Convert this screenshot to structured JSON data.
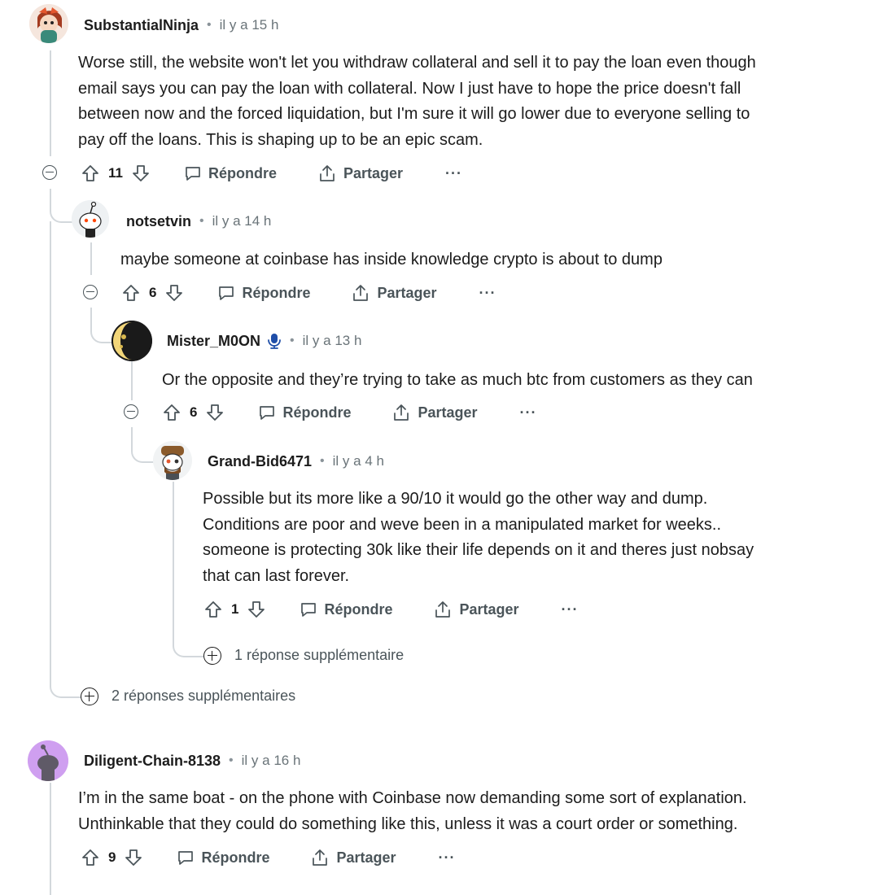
{
  "labels": {
    "reply": "Répondre",
    "share": "Partager",
    "more": "···"
  },
  "comments": [
    {
      "username": "SubstantialNinja",
      "time": "il y a 15 h",
      "lines": [
        "Worse still, the website won't let you withdraw collateral and sell it to pay the loan even though",
        "email says you can pay the loan with collateral. Now I just have to hope the price doesn't fall",
        "between now and the forced liquidation, but I'm sure it will go lower due to everyone selling to",
        "pay off the loans. This is shaping up to be an epic scam."
      ],
      "score": "11"
    },
    {
      "username": "notsetvin",
      "time": "il y a 14 h",
      "lines": [
        "maybe someone at coinbase has inside knowledge crypto is about to dump"
      ],
      "score": "6"
    },
    {
      "username": "Mister_M0ON",
      "time": "il y a 13 h",
      "lines": [
        "Or the opposite and they’re trying to take as much btc from customers as they can"
      ],
      "score": "6"
    },
    {
      "username": "Grand-Bid6471",
      "time": "il y a 4 h",
      "lines": [
        "Possible but its more like a 90/10 it would go the other way and dump.",
        "Conditions are poor and weve been in a manipulated market for weeks..",
        "someone is protecting 30k like their life depends on it and theres just nobsay",
        "that can last forever."
      ],
      "score": "1"
    },
    {
      "username": "Diligent-Chain-8138",
      "time": "il y a 16 h",
      "lines": [
        "I’m in the same boat - on the phone with Coinbase now demanding some sort of explanation.",
        "Unthinkable that they could do something like this, unless it was a court order or something."
      ],
      "score": "9"
    }
  ],
  "more_replies": {
    "grand_bid": "1 réponse supplémentaire",
    "substantial": "2 réponses supplémentaires"
  },
  "colors": {
    "accent_blue": "#0079d3",
    "thread_line": "#d3d8dc",
    "muted": "#6a7479"
  }
}
